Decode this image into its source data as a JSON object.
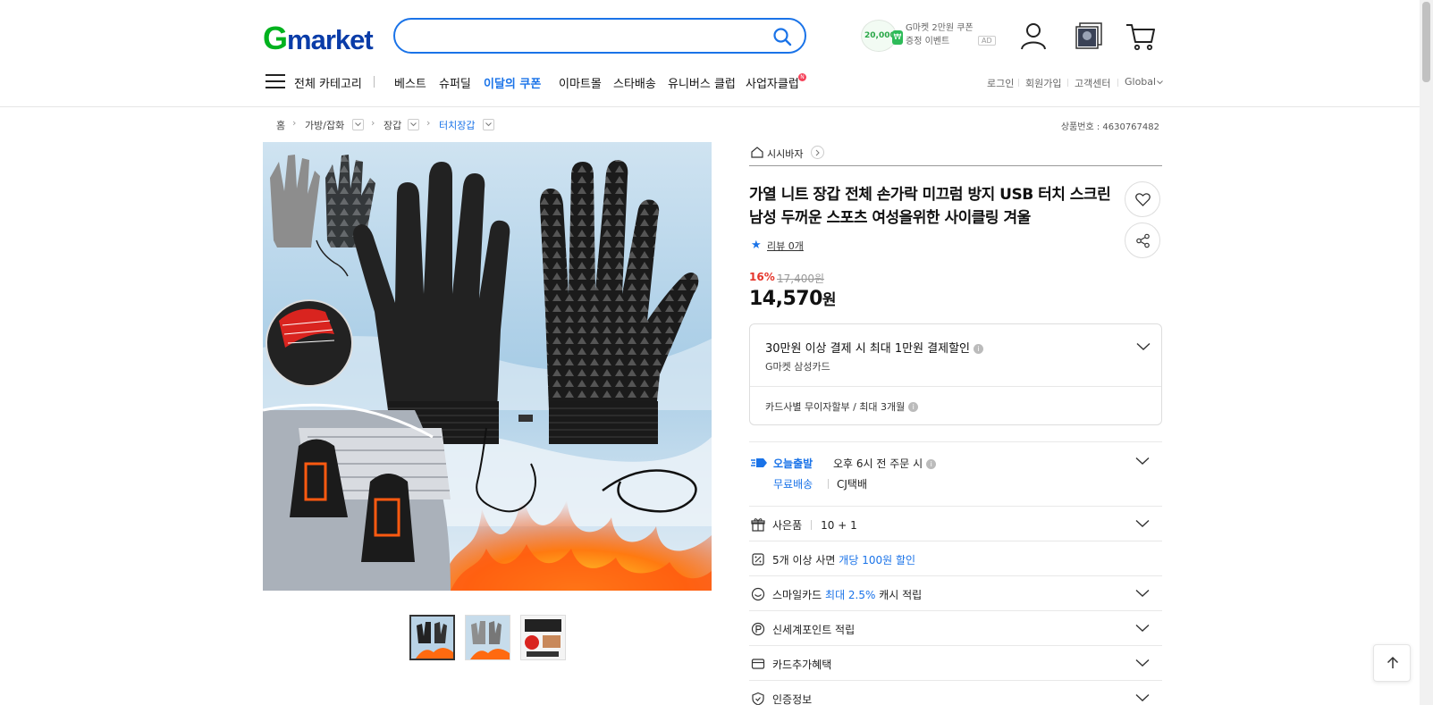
{
  "header": {
    "logo": {
      "g": "G",
      "rest": "market"
    },
    "search": {
      "value": "",
      "placeholder": ""
    },
    "promo": {
      "amount": "20,000",
      "line1": "G마켓 2만원 쿠폰",
      "line2": "증정 이벤트",
      "ad": "AD"
    }
  },
  "nav": {
    "all_category": "전체 카테고리",
    "items": [
      "베스트",
      "슈퍼딜",
      "이달의 쿠폰",
      "이마트몰",
      "스타배송",
      "유니버스 클럽",
      "사업자클럽"
    ],
    "new_badge": "N",
    "util": [
      "로그인",
      "회원가입",
      "고객센터",
      "Global"
    ]
  },
  "breadcrumb": {
    "items": [
      "홈",
      "가방/잡화",
      "장갑",
      "터치장갑"
    ],
    "product_no": "상품번호 : 4630767482"
  },
  "product": {
    "store_name": "시시바자",
    "title": "가열 니트 장갑 전체 손가락 미끄럼 방지 USB 터치 스크린 남성 두꺼운 스포츠 여성을위한 사이클링 겨울",
    "review": "리뷰 0개",
    "discount_rate": "16%",
    "original_price": "17,400원",
    "price": "14,570",
    "price_unit": "원"
  },
  "card_benefit": {
    "title": "30만원 이상 결제 시 최대 1만원 결제할인",
    "card": "G마켓 삼성카드",
    "installment": "카드사별 무이자할부 / 최대 3개월"
  },
  "shipping": {
    "badge": "오늘출발",
    "cutoff": "오후 6시 전 주문 시",
    "fee": "무료배송",
    "carrier": "CJ택배"
  },
  "rows": {
    "gift_label": "사은품",
    "gift_value": "10 + 1",
    "bulk_prefix": "5개 이상 사면",
    "bulk_highlight": "개당 100원 할인",
    "smile_prefix": "스마일카드",
    "smile_highlight": "최대 2.5%",
    "smile_suffix": "캐시 적립",
    "point": "신세계포인트 적립",
    "card_extra": "카드추가혜택",
    "cert": "인증정보"
  },
  "colors": {
    "accent": "#1a73e8",
    "discount": "#e5352b",
    "logo_green": "#00b21e"
  }
}
